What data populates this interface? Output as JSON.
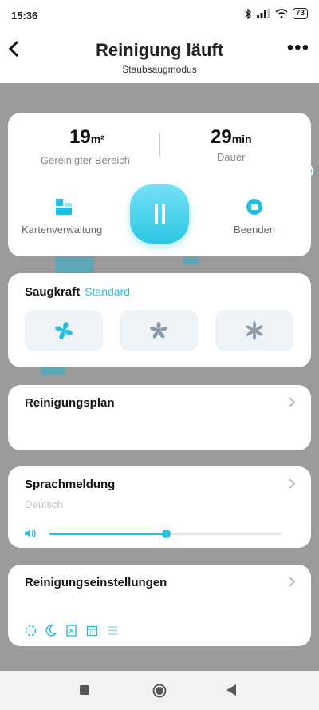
{
  "status_bar": {
    "time": "15:36",
    "battery": "73",
    "icons": [
      "bluetooth-icon",
      "signal-icon",
      "wifi-icon"
    ]
  },
  "header": {
    "title": "Reinigung läuft",
    "subtitle": "Staubsaugmodus",
    "back_icon": "‹",
    "more_icon": "•••"
  },
  "stats": {
    "area_value": "19",
    "area_unit": "m²",
    "area_label": "Gereinigter Bereich",
    "duration_value": "29",
    "duration_unit": "min",
    "duration_label": "Dauer"
  },
  "actions": {
    "map_label": "Kartenverwaltung",
    "stop_label": "Beenden"
  },
  "suction": {
    "title": "Saugkraft",
    "mode": "Standard"
  },
  "cleaning_plan": {
    "title": "Reinigungsplan"
  },
  "voice": {
    "title": "Sprachmeldung",
    "language": "Deutsch",
    "volume_fraction": 0.5
  },
  "settings": {
    "title": "Reinigungseinstellungen"
  },
  "colors": {
    "accent": "#23bfe0",
    "map": "#9b9b9b",
    "card": "#ffffff"
  }
}
